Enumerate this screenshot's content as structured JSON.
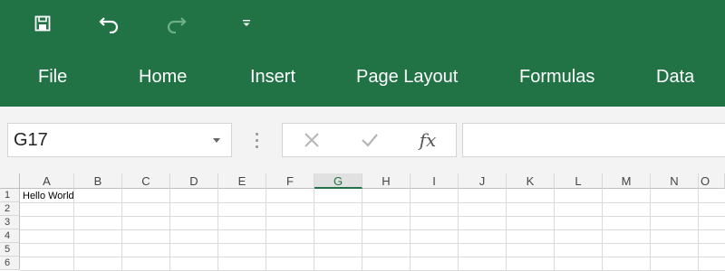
{
  "quick_access": {
    "save_icon": "save-icon",
    "undo_icon": "undo-icon",
    "redo_icon": "redo-icon",
    "customize_icon": "customize-dropdown-icon"
  },
  "ribbon_tabs": [
    "File",
    "Home",
    "Insert",
    "Page Layout",
    "Formulas",
    "Data"
  ],
  "formula_bar": {
    "name_box_value": "G17",
    "formula_value": "",
    "cancel_icon": "cancel-x-icon",
    "enter_icon": "check-icon",
    "insert_function_label": "fx"
  },
  "sheet": {
    "columns": [
      "A",
      "B",
      "C",
      "D",
      "E",
      "F",
      "G",
      "H",
      "I",
      "J",
      "K",
      "L",
      "M",
      "N",
      "O"
    ],
    "active_column": "G",
    "rows": [
      "1",
      "2",
      "3",
      "4",
      "5",
      "6"
    ],
    "cells": {
      "A1": "Hello World"
    }
  },
  "colors": {
    "accent": "#217346",
    "ribbon_text": "#ffffff",
    "grid_line": "#dadada",
    "header_bg": "#f3f3f3"
  }
}
